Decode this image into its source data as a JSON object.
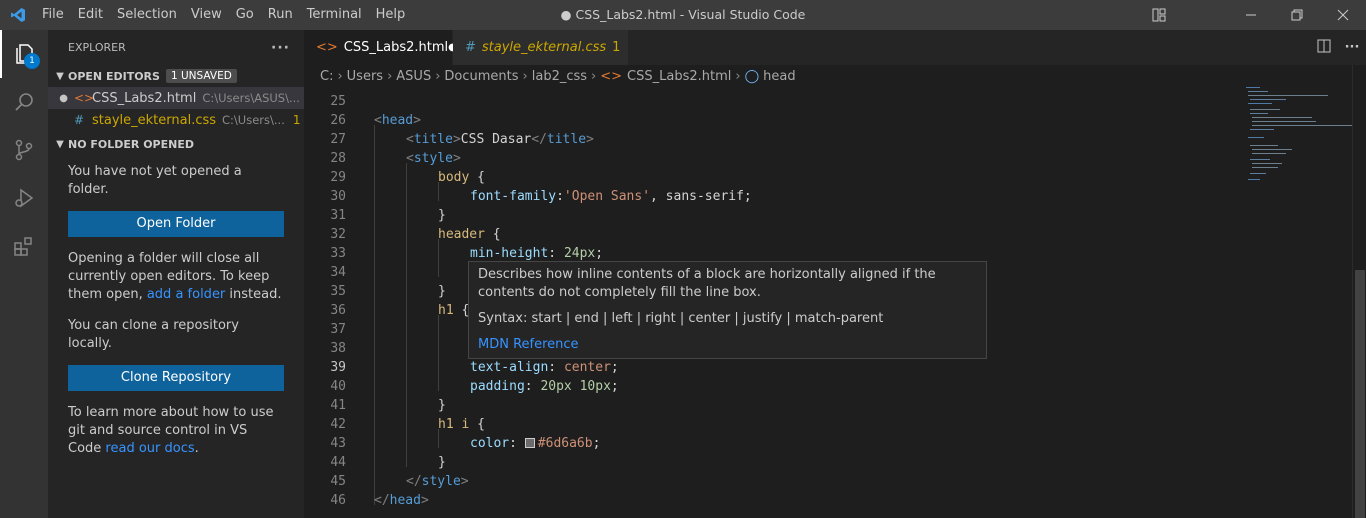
{
  "window": {
    "title": "● CSS_Labs2.html - Visual Studio Code",
    "menu": [
      "File",
      "Edit",
      "Selection",
      "View",
      "Go",
      "Run",
      "Terminal",
      "Help"
    ]
  },
  "activity_bar": {
    "items": [
      "explorer-icon",
      "search-icon",
      "source-control-icon",
      "run-debug-icon",
      "extensions-icon"
    ],
    "explorer_badge": "1"
  },
  "sidebar": {
    "title": "EXPLORER",
    "more_label": "···",
    "open_editors": {
      "header": "OPEN EDITORS",
      "badge": "1 UNSAVED",
      "items": [
        {
          "name": "CSS_Labs2.html",
          "path": "C:\\Users\\ASUS\\...",
          "icon": "<>",
          "dirty": "●",
          "modified": ""
        },
        {
          "name": "stayle_ekternal.css",
          "path": "C:\\Users\\...",
          "icon": "#",
          "dirty": "",
          "modified": "1"
        }
      ]
    },
    "no_folder": {
      "header": "NO FOLDER OPENED",
      "msg1": "You have not yet opened a folder.",
      "open_button": "Open Folder",
      "msg2_prefix": "Opening a folder will close all currently open editors. To keep them open, ",
      "msg2_link": "add a folder",
      "msg2_suffix": " instead.",
      "msg3": "You can clone a repository locally.",
      "clone_button": "Clone Repository",
      "msg4_prefix": "To learn more about how to use git and source control in VS Code ",
      "msg4_link": "read our docs",
      "msg4_suffix": "."
    }
  },
  "tabs": [
    {
      "label": "CSS_Labs2.html",
      "icon": "<>",
      "dirty": "●"
    },
    {
      "label": "stayle_ekternal.css",
      "icon": "#",
      "modified": "1"
    }
  ],
  "breadcrumb": [
    "C:",
    "Users",
    "ASUS",
    "Documents",
    "lab2_css",
    "CSS_Labs2.html",
    "head"
  ],
  "editor": {
    "lines": [
      {
        "n": "25"
      },
      {
        "n": "26"
      },
      {
        "n": "27"
      },
      {
        "n": "28"
      },
      {
        "n": "29"
      },
      {
        "n": "30"
      },
      {
        "n": "31"
      },
      {
        "n": "32"
      },
      {
        "n": "33"
      },
      {
        "n": "34"
      },
      {
        "n": "35"
      },
      {
        "n": "36"
      },
      {
        "n": "37"
      },
      {
        "n": "38"
      },
      {
        "n": "39"
      },
      {
        "n": "40"
      },
      {
        "n": "41"
      },
      {
        "n": "42"
      },
      {
        "n": "43"
      },
      {
        "n": "44"
      },
      {
        "n": "45"
      },
      {
        "n": "46"
      }
    ],
    "code": {
      "l26_open": "<",
      "l26_tag": "head",
      "l26_close": ">",
      "l27_title_text": "CSS Dasar",
      "l29_sel": "body",
      "l30_prop": "font-family",
      "l30_str": "'Open Sans'",
      "l30_rest": ", sans-serif;",
      "l32_sel": "header",
      "l33_prop": "min-height",
      "l33_val": "24px",
      "l36_sel": "h1",
      "l39_prop": "text-align",
      "l39_val": "center",
      "l40_prop": "padding",
      "l40_val": "20px 10px",
      "l42_sel": "h1 i",
      "l43_prop": "color",
      "l43_val": "#6d6a6b",
      "brace_open": "{",
      "brace_close": "}"
    },
    "hover": {
      "description": "Describes how inline contents of a block are horizontally aligned if the contents do not completely fill the line box.",
      "syntax": "Syntax: start | end | left | right | center | justify | match-parent",
      "reference": "MDN Reference"
    }
  }
}
